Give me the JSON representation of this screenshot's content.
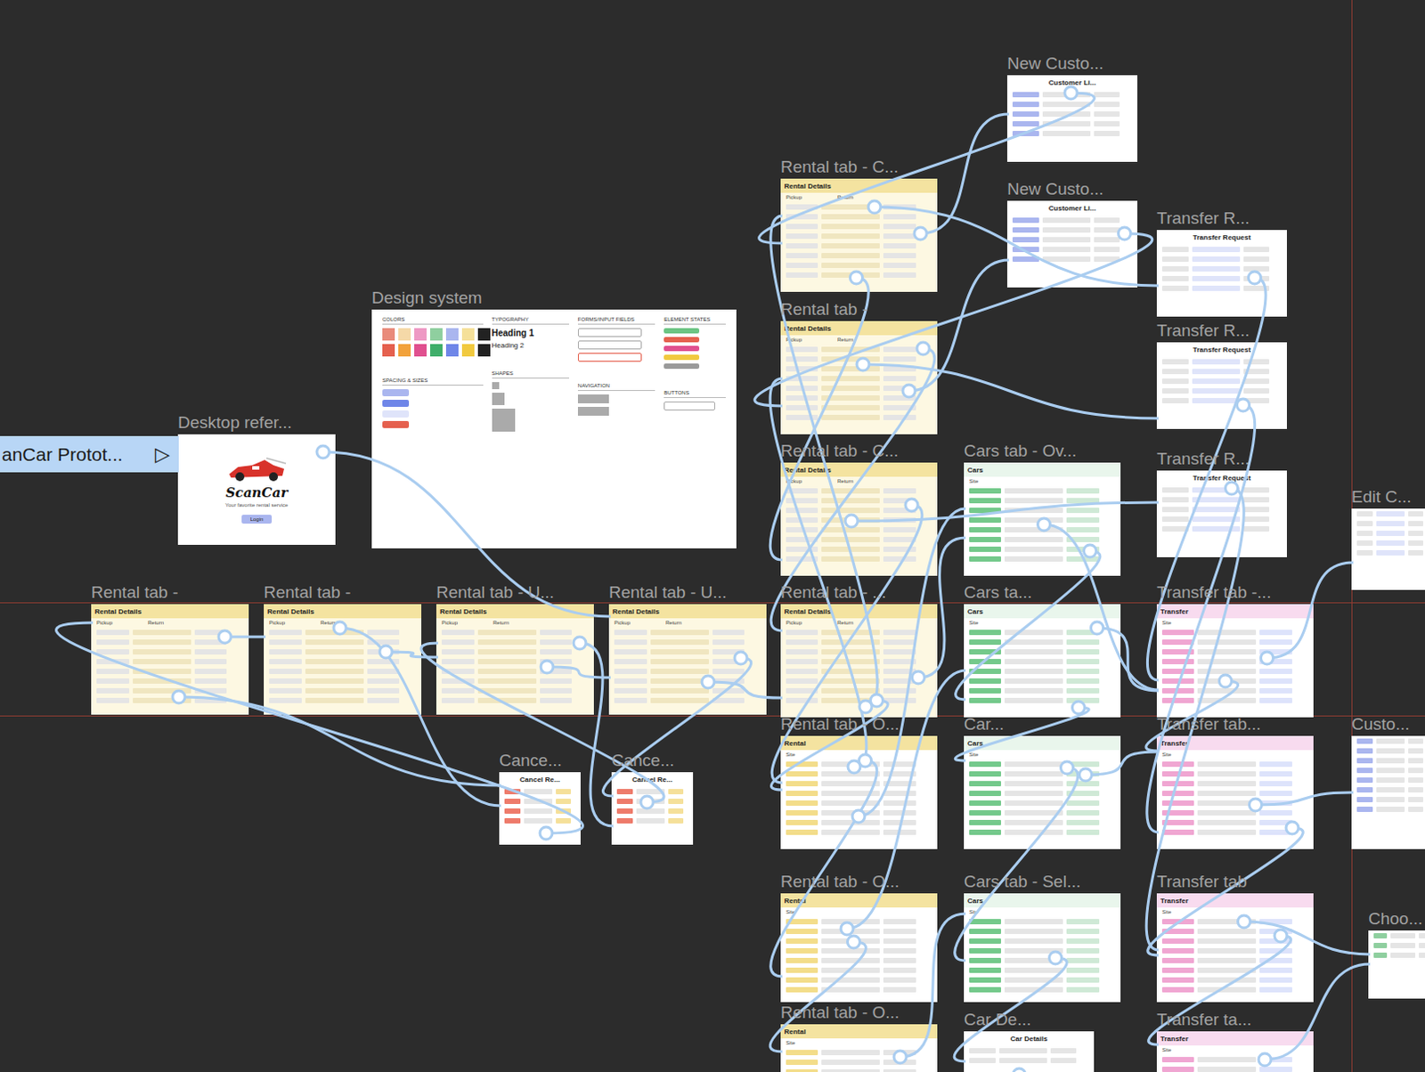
{
  "prototype": {
    "label": "anCar Protot...",
    "icon": "▷"
  },
  "frames": [
    {
      "label": "Desktop refer...",
      "kind": "desktop",
      "title": "ScanCar",
      "fields": [
        "Your favorite rental service",
        "Login"
      ]
    },
    {
      "label": "Design system",
      "kind": "design",
      "title": "COLORS",
      "fields": [
        "TYPOGRAPHY",
        "FORMS/INPUT FIELDS",
        "ELEMENT STATES",
        "BUTTONS",
        "SPACING & SIZES",
        "SHAPES",
        "NAVIGATION",
        "Heading 1",
        "Heading 2"
      ]
    },
    {
      "label": "New Custo...",
      "kind": "customer",
      "title": "Customer Li...",
      "fields": []
    },
    {
      "label": "New Custo...",
      "kind": "customer",
      "title": "Customer Li...",
      "fields": []
    },
    {
      "label": "Rental tab - C...",
      "kind": "rental",
      "title": "Rental Details",
      "fields": [
        "Pickup",
        "Return"
      ]
    },
    {
      "label": "Rental tab -",
      "kind": "rental",
      "title": "Rental Details",
      "fields": [
        "Pickup",
        "Return"
      ]
    },
    {
      "label": "Rental tab - C...",
      "kind": "rental",
      "title": "Rental Details",
      "fields": [
        "Pickup",
        "Return"
      ]
    },
    {
      "label": "Rental tab - ...",
      "kind": "rental",
      "title": "Rental Details",
      "fields": [
        "Pickup",
        "Return"
      ]
    },
    {
      "label": "Rental tab - O...",
      "kind": "rental-list",
      "title": "Rental",
      "fields": [
        "Site"
      ]
    },
    {
      "label": "Rental tab - O...",
      "kind": "rental-list",
      "title": "Rental",
      "fields": [
        "Site"
      ]
    },
    {
      "label": "Rental tab - O...",
      "kind": "rental-list",
      "title": "Rental",
      "fields": [
        "Site"
      ]
    },
    {
      "label": "Cars tab - Ov...",
      "kind": "cars",
      "title": "Cars",
      "fields": [
        "Site"
      ]
    },
    {
      "label": "Cars ta...",
      "kind": "cars",
      "title": "Cars",
      "fields": [
        "Site"
      ]
    },
    {
      "label": "Car...",
      "kind": "cars",
      "title": "Cars",
      "fields": [
        "Site"
      ]
    },
    {
      "label": "Cars tab - Sel...",
      "kind": "cars",
      "title": "Cars",
      "fields": [
        "Site"
      ]
    },
    {
      "label": "Car De...",
      "kind": "details",
      "title": "Car Details",
      "fields": []
    },
    {
      "label": "Transfer R...",
      "kind": "request",
      "title": "Transfer Request",
      "fields": []
    },
    {
      "label": "Transfer R...",
      "kind": "request",
      "title": "Transfer Request",
      "fields": []
    },
    {
      "label": "Transfer R...",
      "kind": "request",
      "title": "Transfer Request",
      "fields": []
    },
    {
      "label": "Transfer tab -...",
      "kind": "transfer",
      "title": "Transfer",
      "fields": [
        "Site"
      ]
    },
    {
      "label": "Transfer tab...",
      "kind": "transfer",
      "title": "Transfer",
      "fields": [
        "Site"
      ]
    },
    {
      "label": "Transfer tab",
      "kind": "transfer",
      "title": "Transfer",
      "fields": [
        "Site"
      ]
    },
    {
      "label": "Transfer ta...",
      "kind": "transfer",
      "title": "Transfer",
      "fields": [
        "Site"
      ]
    },
    {
      "label": "Rental tab -",
      "kind": "rental",
      "title": "Rental Details",
      "fields": [
        "Pickup",
        "Return"
      ]
    },
    {
      "label": "Rental tab -",
      "kind": "rental",
      "title": "Rental Details",
      "fields": [
        "Pickup",
        "Return"
      ]
    },
    {
      "label": "Rental tab - U...",
      "kind": "rental",
      "title": "Rental Details",
      "fields": [
        "Pickup",
        "Return"
      ]
    },
    {
      "label": "Rental tab - U...",
      "kind": "rental",
      "title": "Rental Details",
      "fields": [
        "Pickup",
        "Return"
      ]
    },
    {
      "label": "Cance...",
      "kind": "cancel",
      "title": "Cancel Re...",
      "fields": []
    },
    {
      "label": "Cance...",
      "kind": "cancel",
      "title": "Cancel Re...",
      "fields": []
    },
    {
      "label": "Edit C...",
      "kind": "edit",
      "title": "",
      "fields": []
    },
    {
      "label": "Custo...",
      "kind": "customer",
      "title": "",
      "fields": []
    },
    {
      "label": "Choo...",
      "kind": "choose",
      "title": "",
      "fields": []
    }
  ],
  "swatches": [
    {
      "color": "#e98b7b"
    },
    {
      "color": "#f5d9a8"
    },
    {
      "color": "#ee99c4"
    },
    {
      "color": "#8fcf9f"
    },
    {
      "color": "#aab6ef"
    },
    {
      "color": "#f5e09a"
    },
    {
      "color": "#222222"
    },
    {
      "color": "#e5604e"
    },
    {
      "color": "#f2a23b"
    },
    {
      "color": "#e0508f"
    },
    {
      "color": "#3fae6a"
    },
    {
      "color": "#6f86e8"
    },
    {
      "color": "#f1c93f"
    },
    {
      "color": "#222222"
    }
  ],
  "states": [
    {
      "color": "#6cc483"
    },
    {
      "color": "#e5604e"
    },
    {
      "color": "#e0508f"
    },
    {
      "color": "#f1c93f"
    },
    {
      "color": "#9a9a9a"
    }
  ],
  "connections": [
    {
      "from": 0,
      "to": 26
    },
    {
      "from": 23,
      "to": 24
    },
    {
      "from": 24,
      "to": 25
    },
    {
      "from": 25,
      "to": 26
    },
    {
      "from": 26,
      "to": 7
    },
    {
      "from": 23,
      "to": 27
    },
    {
      "from": 24,
      "to": 27
    },
    {
      "from": 25,
      "to": 28
    },
    {
      "from": 26,
      "to": 28
    },
    {
      "from": 27,
      "to": 23
    },
    {
      "from": 28,
      "to": 25
    },
    {
      "from": 7,
      "to": 8
    },
    {
      "from": 8,
      "to": 9
    },
    {
      "from": 9,
      "to": 10
    },
    {
      "from": 4,
      "to": 2
    },
    {
      "from": 5,
      "to": 3
    },
    {
      "from": 2,
      "to": 4
    },
    {
      "from": 3,
      "to": 5
    },
    {
      "from": 4,
      "to": 16
    },
    {
      "from": 5,
      "to": 17
    },
    {
      "from": 6,
      "to": 18
    },
    {
      "from": 7,
      "to": 11
    },
    {
      "from": 11,
      "to": 12
    },
    {
      "from": 12,
      "to": 13
    },
    {
      "from": 13,
      "to": 14
    },
    {
      "from": 14,
      "to": 15
    },
    {
      "from": 11,
      "to": 19
    },
    {
      "from": 19,
      "to": 20
    },
    {
      "from": 20,
      "to": 21
    },
    {
      "from": 21,
      "to": 22
    },
    {
      "from": 16,
      "to": 19
    },
    {
      "from": 17,
      "to": 20
    },
    {
      "from": 18,
      "to": 21
    },
    {
      "from": 8,
      "to": 11
    },
    {
      "from": 9,
      "to": 12
    },
    {
      "from": 12,
      "to": 19
    },
    {
      "from": 13,
      "to": 20
    },
    {
      "from": 19,
      "to": 29
    },
    {
      "from": 20,
      "to": 30
    },
    {
      "from": 21,
      "to": 31
    },
    {
      "from": 4,
      "to": 6
    },
    {
      "from": 5,
      "to": 7
    },
    {
      "from": 6,
      "to": 8
    },
    {
      "from": 10,
      "to": 14
    },
    {
      "from": 22,
      "to": 31
    },
    {
      "from": 15,
      "to": 22
    },
    {
      "from": 7,
      "to": 4
    },
    {
      "from": 8,
      "to": 5
    }
  ]
}
